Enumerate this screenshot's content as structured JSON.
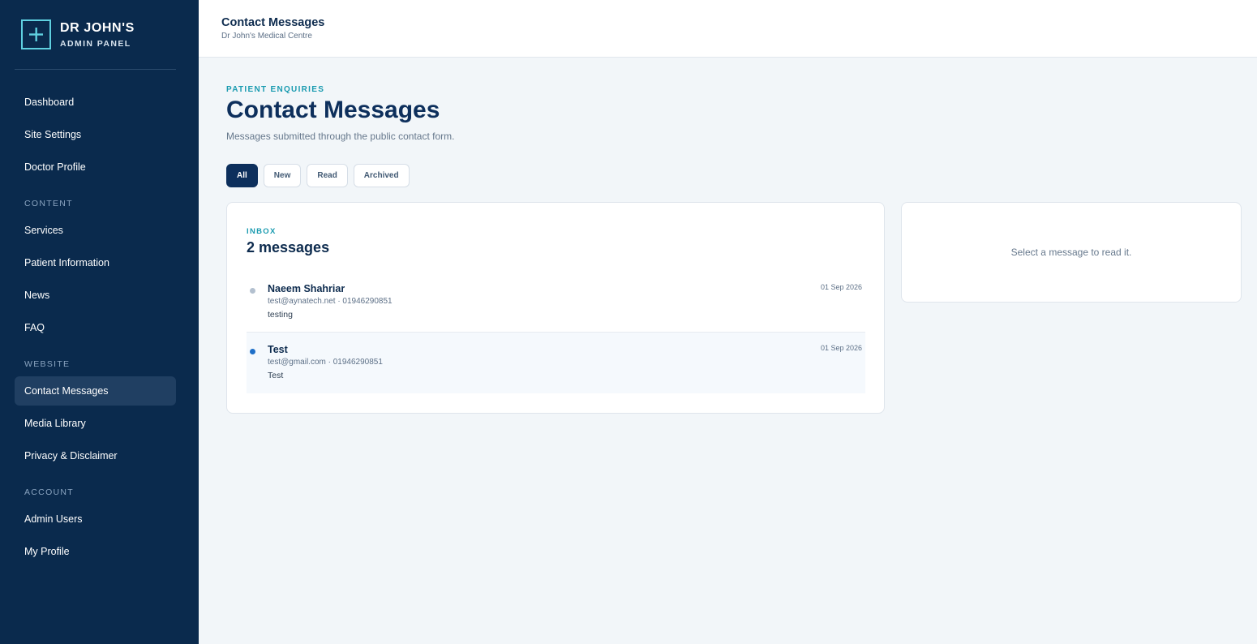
{
  "brand": {
    "title": "DR JOHN'S",
    "subtitle": "ADMIN PANEL"
  },
  "sidebar": {
    "items": [
      {
        "label": "Dashboard"
      },
      {
        "label": "Site Settings"
      },
      {
        "label": "Doctor Profile"
      },
      {
        "label": "Services"
      },
      {
        "label": "Patient Information"
      },
      {
        "label": "News"
      },
      {
        "label": "FAQ"
      },
      {
        "label": "Contact Messages",
        "active": true
      },
      {
        "label": "Media Library"
      },
      {
        "label": "Privacy & Disclaimer"
      },
      {
        "label": "Admin Users"
      },
      {
        "label": "My Profile"
      }
    ],
    "sections": [
      {
        "label": "CONTENT"
      },
      {
        "label": "WEBSITE"
      },
      {
        "label": "ACCOUNT"
      }
    ]
  },
  "topbar": {
    "title": "Contact Messages",
    "subtitle": "Dr John's Medical Centre"
  },
  "page": {
    "eyebrow": "PATIENT ENQUIRIES",
    "title": "Contact Messages",
    "description": "Messages submitted through the public contact form."
  },
  "filters": [
    {
      "label": "All",
      "active": true
    },
    {
      "label": "New"
    },
    {
      "label": "Read"
    },
    {
      "label": "Archived"
    }
  ],
  "inbox": {
    "eyebrow": "INBOX",
    "count_label": "2 messages",
    "messages": [
      {
        "name": "Naeem Shahriar",
        "meta": "test@aynatech.net · 01946290851",
        "preview": "testing",
        "date": "01 Sep 2026",
        "status": "read"
      },
      {
        "name": "Test",
        "meta": "test@gmail.com · 01946290851",
        "preview": "Test",
        "date": "01 Sep 2026",
        "status": "new"
      }
    ]
  },
  "reader": {
    "empty_text": "Select a message to read it."
  },
  "colors": {
    "sidebar_bg": "#0a2a4d",
    "accent_teal": "#1a9bb0",
    "primary": "#0d2f5c",
    "unread_dot": "#1e6fc8",
    "read_dot": "#b3c0cf"
  }
}
